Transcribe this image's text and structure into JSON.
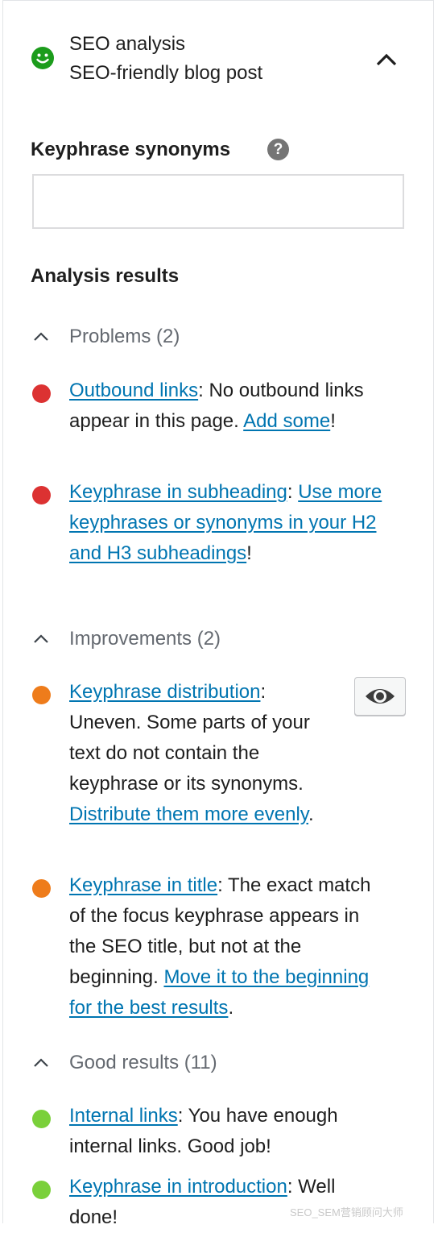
{
  "header": {
    "title": "SEO analysis",
    "subtitle": "SEO-friendly blog post",
    "status_icon": "smiley-good-icon",
    "collapse_icon": "chevron-up-icon"
  },
  "synonyms": {
    "label": "Keyphrase synonyms",
    "help_icon": "question-mark",
    "help_glyph": "?",
    "value": "",
    "placeholder": ""
  },
  "analysis": {
    "title": "Analysis results",
    "groups": [
      {
        "label": "Problems (2)",
        "items": [
          {
            "color": "#dc3232",
            "parts": [
              {
                "t": "Outbound links",
                "link": true
              },
              {
                "t": ": No outbound links appear in this page. "
              },
              {
                "t": "Add some",
                "link": true
              },
              {
                "t": "!"
              }
            ]
          },
          {
            "color": "#dc3232",
            "parts": [
              {
                "t": "Keyphrase in subheading",
                "link": true
              },
              {
                "t": ": "
              },
              {
                "t": "Use more keyphrases or synonyms in your H2 and H3 subheadings",
                "link": true
              },
              {
                "t": "!"
              }
            ]
          }
        ]
      },
      {
        "label": "Improvements (2)",
        "items": [
          {
            "color": "#ee7c1b",
            "eye": true,
            "parts": [
              {
                "t": "Keyphrase distribution",
                "link": true
              },
              {
                "t": ": Uneven. Some parts of your text do not contain the keyphrase or its synonyms. "
              },
              {
                "t": "Distribute them more evenly",
                "link": true
              },
              {
                "t": "."
              }
            ]
          },
          {
            "color": "#ee7c1b",
            "parts": [
              {
                "t": "Keyphrase in title",
                "link": true
              },
              {
                "t": ": The exact match of the focus keyphrase appears in the SEO title, but not at the beginning. "
              },
              {
                "t": "Move it to the beginning for the best results",
                "link": true
              },
              {
                "t": "."
              }
            ]
          }
        ]
      },
      {
        "label": "Good results (11)",
        "items": [
          {
            "color": "#7ad03a",
            "parts": [
              {
                "t": "Internal links",
                "link": true
              },
              {
                "t": ": You have enough internal links. Good job!"
              }
            ]
          },
          {
            "color": "#7ad03a",
            "parts": [
              {
                "t": "Keyphrase in introduction",
                "link": true
              },
              {
                "t": ": Well done!"
              }
            ]
          }
        ]
      }
    ]
  },
  "eye_icon": "eye-icon",
  "watermark": "SEO_SEM营销顾问大师"
}
